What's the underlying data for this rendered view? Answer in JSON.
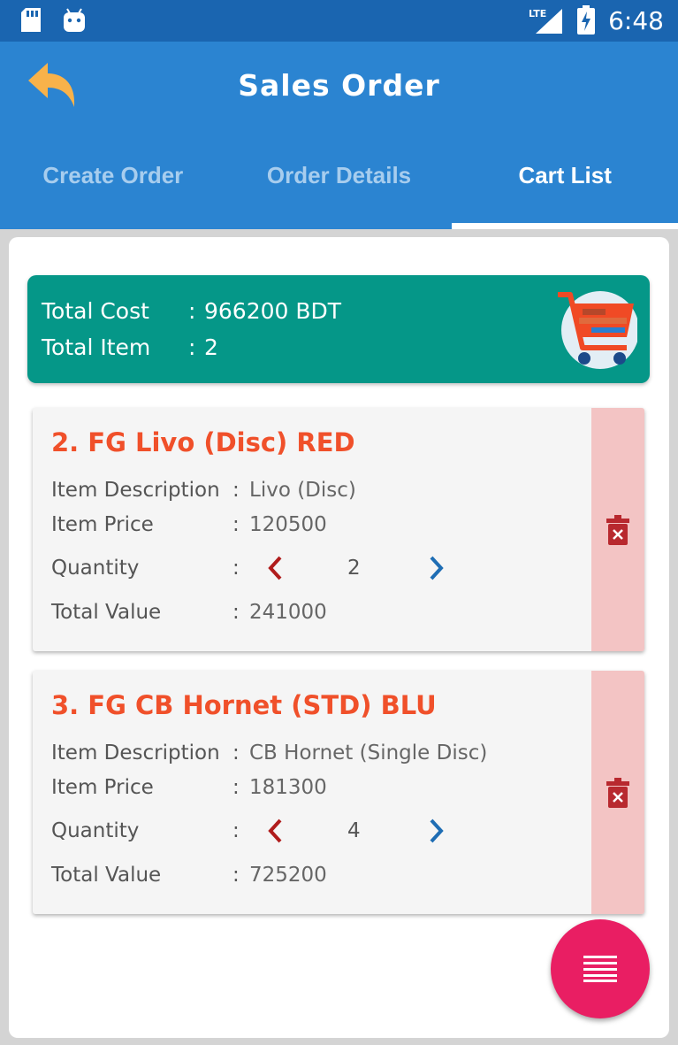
{
  "status_bar": {
    "network": "LTE",
    "time": "6:48"
  },
  "app_bar": {
    "title": "Sales Order"
  },
  "tabs": [
    {
      "label": "Create Order",
      "active": false
    },
    {
      "label": "Order Details",
      "active": false
    },
    {
      "label": "Cart List",
      "active": true
    }
  ],
  "summary": {
    "total_cost_label": "Total Cost",
    "total_cost_value": "966200 BDT",
    "total_item_label": "Total Item",
    "total_item_value": "2",
    "separator": ":"
  },
  "cart_items": [
    {
      "title": "2. FG Livo (Disc) RED",
      "description_label": "Item Description",
      "description": "Livo (Disc)",
      "price_label": "Item Price",
      "price": "120500",
      "quantity_label": "Quantity",
      "quantity": "2",
      "total_label": "Total Value",
      "total": "241000"
    },
    {
      "title": "3. FG CB Hornet (STD) BLU",
      "description_label": "Item Description",
      "description": "CB Hornet (Single Disc)",
      "price_label": "Item Price",
      "price": "181300",
      "quantity_label": "Quantity",
      "quantity": "4",
      "total_label": "Total Value",
      "total": "725200"
    }
  ],
  "colors": {
    "status_bar": "#1a65b0",
    "app_bar": "#2b84d1",
    "summary_bg": "#059788",
    "item_title": "#f0502a",
    "delete_bg": "#f3c4c4",
    "delete_icon": "#b8292f",
    "qty_dec": "#b01c1c",
    "qty_inc": "#1e6db4",
    "fab": "#e91e63"
  },
  "icons": {
    "back": "back-arrow-icon",
    "cart": "shopping-cart-icon",
    "delete": "trash-delete-icon",
    "decrease": "chevron-left-icon",
    "increase": "chevron-right-icon",
    "fab": "menu-lines-icon"
  }
}
